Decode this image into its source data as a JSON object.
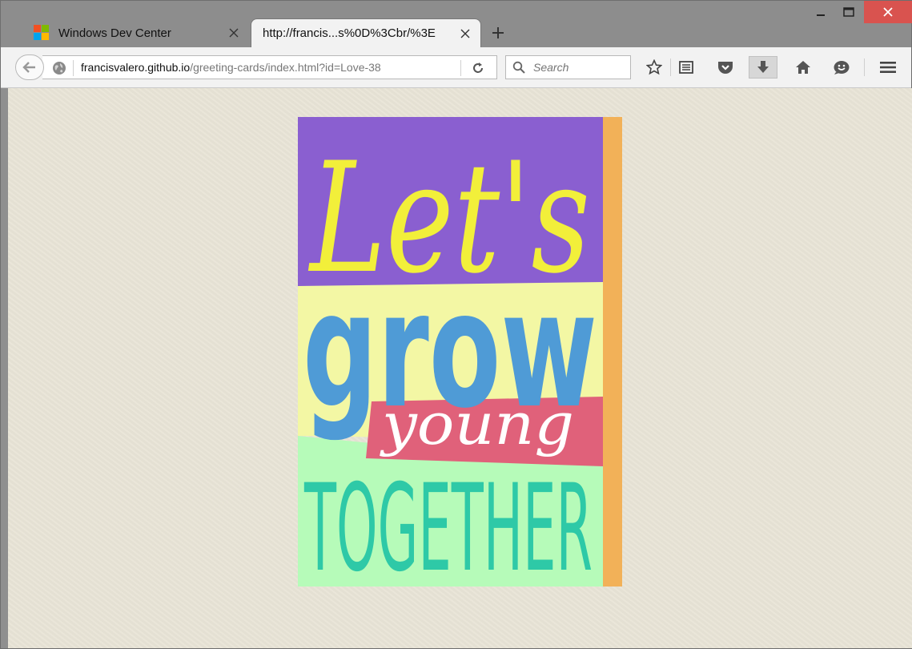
{
  "browser": {
    "tabs": [
      {
        "label": "Windows Dev Center",
        "active": false,
        "icon": "windows-logo-icon"
      },
      {
        "label": "http://francis...s%0D%3Cbr/%3E",
        "active": true
      }
    ],
    "url": {
      "host": "francisvalero.github.io",
      "path": "/greeting-cards/index.html?id=Love-38"
    },
    "search_placeholder": "Search",
    "toolbar_icons": [
      "star-icon",
      "reading-list-icon",
      "pocket-icon",
      "download-icon",
      "home-icon",
      "hello-icon",
      "menu-icon"
    ]
  },
  "card": {
    "line1": "Let's",
    "line2": "grow",
    "line3": "young",
    "line4": "TOGETHER",
    "colors": {
      "purple": "#8a5fd0",
      "yellow_text": "#f2ef3a",
      "pale_yellow": "#f3f7a4",
      "blue_text": "#4f9bd6",
      "pink": "#e0617a",
      "mint": "#b6fbb9",
      "teal_text": "#2ec9a7",
      "orange_strip": "#f2b158"
    }
  }
}
